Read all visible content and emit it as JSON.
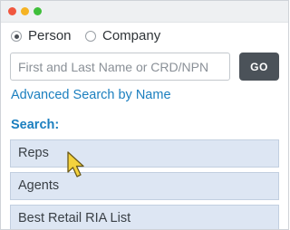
{
  "window": {
    "controls": [
      "close",
      "minimize",
      "maximize"
    ]
  },
  "search_type": {
    "options": [
      {
        "label": "Person",
        "selected": true
      },
      {
        "label": "Company",
        "selected": false
      }
    ]
  },
  "search": {
    "placeholder": "First and Last Name or CRD/NPN",
    "value": "",
    "button_label": "GO"
  },
  "advanced_link": "Advanced Search by Name",
  "section": {
    "title": "Search:",
    "items": [
      {
        "label": "Reps"
      },
      {
        "label": "Agents"
      },
      {
        "label": "Best Retail RIA List"
      }
    ]
  },
  "colors": {
    "accent": "#1b7fbf",
    "button": "#4b5259",
    "list_bg": "#dde6f3",
    "cursor": "#f5d33d"
  },
  "icons": [
    "pointer-cursor-icon"
  ]
}
